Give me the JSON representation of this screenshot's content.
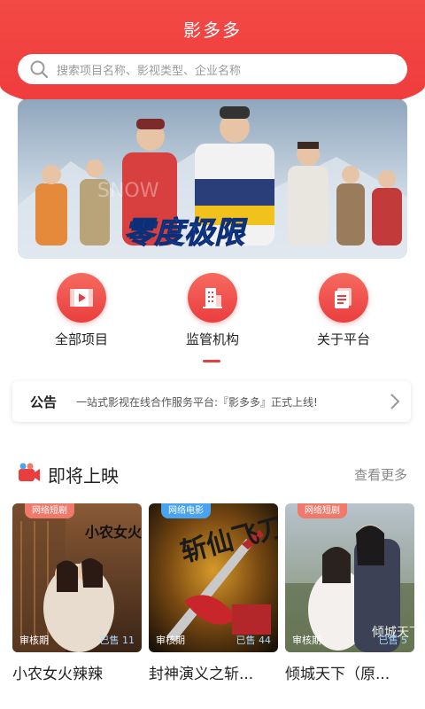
{
  "app": {
    "title": "影多多"
  },
  "search": {
    "placeholder": "搜索项目名称、影视类型、企业名称",
    "icon": "search-icon"
  },
  "banner": {
    "title_text": "零度极限",
    "watermark": "SNOW"
  },
  "nav": [
    {
      "label": "全部项目",
      "icon": "video-icon"
    },
    {
      "label": "监管机构",
      "icon": "building-icon"
    },
    {
      "label": "关于平台",
      "icon": "document-icon"
    }
  ],
  "notice": {
    "tag": "公告",
    "text": "一站式影视在线合作服务平台:『影多多』正式上线!"
  },
  "section": {
    "title": "即将上映",
    "more": "查看更多",
    "icon": "film-icon"
  },
  "cards": [
    {
      "badge": "网络短剧",
      "status": "审核期",
      "sold": "已售 11",
      "title": "小农女火辣辣",
      "poster_text": "小农女火辣辣"
    },
    {
      "badge": "网络电影",
      "status": "审核期",
      "sold": "已售 44",
      "title": "封神演义之斩...",
      "poster_text": "斩仙飞刀"
    },
    {
      "badge": "网络短剧",
      "status": "审核期",
      "sold": "已售 5",
      "title": "倾城天下（原...",
      "poster_text": "倾城天下"
    }
  ],
  "colors": {
    "accent": "#ea3e3e",
    "badge_short": "#ef7a6b",
    "badge_movie": "#4aa3f0"
  }
}
